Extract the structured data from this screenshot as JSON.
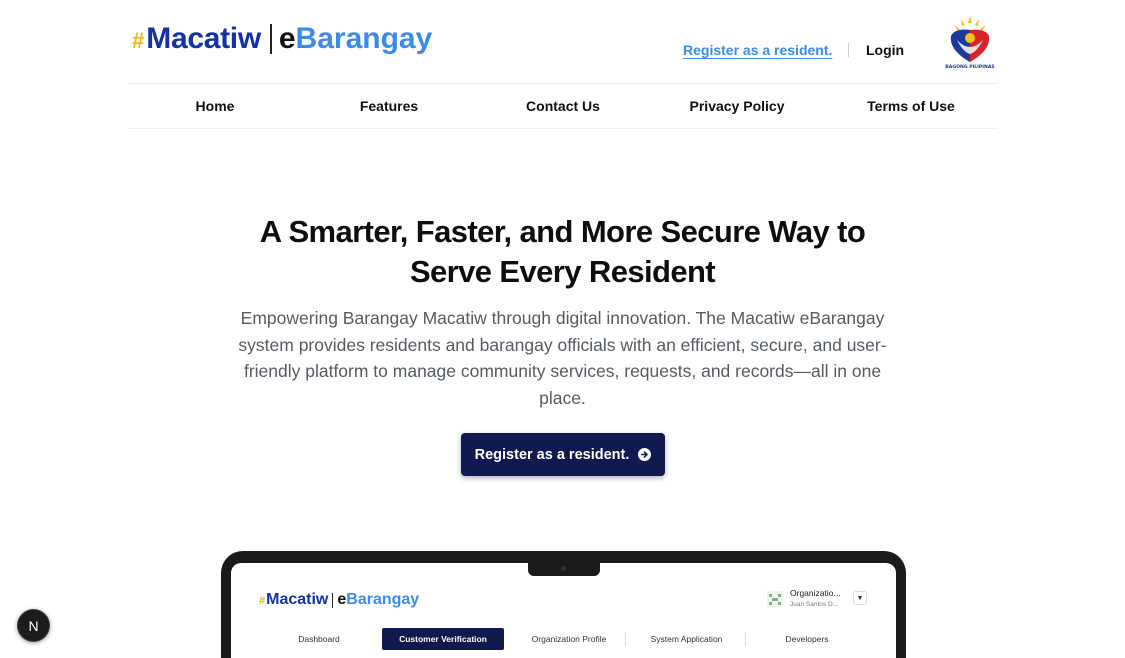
{
  "header": {
    "brand": {
      "hash": "#",
      "name": "Macatiw",
      "e": "e",
      "product": "Barangay"
    },
    "register_link": "Register as a resident.",
    "login_link": "Login",
    "partner_logo_text": "BAGONG PILIPINAS"
  },
  "nav": {
    "items": [
      {
        "label": "Home"
      },
      {
        "label": "Features"
      },
      {
        "label": "Contact Us"
      },
      {
        "label": "Privacy Policy"
      },
      {
        "label": "Terms of Use"
      }
    ]
  },
  "hero": {
    "title_line1": "A Smarter, Faster, and More Secure Way to",
    "title_line2": "Serve Every Resident",
    "description": "Empowering Barangay Macatiw through digital innovation. The Macatiw eBarangay system provides residents and barangay officials with an efficient, secure, and user-friendly platform to manage community services, requests, and records—all in one place.",
    "cta_label": "Register as a resident."
  },
  "preview": {
    "brand": {
      "hash": "#",
      "name": "Macatiw",
      "e": "e",
      "product": "Barangay"
    },
    "org_name": "Organizatio...",
    "org_user": "Juan Santos D...",
    "tabs": [
      {
        "label": "Dashboard",
        "active": false
      },
      {
        "label": "Customer Verification",
        "active": true
      },
      {
        "label": "Organization Profile",
        "active": false
      },
      {
        "label": "System Application",
        "active": false
      },
      {
        "label": "Developers",
        "active": false
      }
    ]
  },
  "dev_badge": {
    "letter": "N"
  },
  "colors": {
    "brand_navy": "#1232a6",
    "brand_blue": "#3d8be8",
    "brand_gold": "#f2b705",
    "cta_bg": "#101a4e"
  }
}
